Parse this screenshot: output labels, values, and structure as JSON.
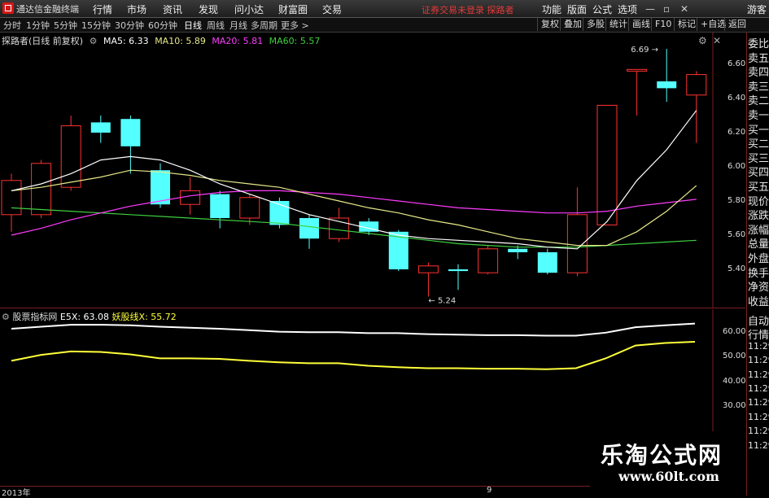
{
  "app": {
    "title": "通达信金融终端",
    "menu": [
      "行情",
      "市场",
      "资讯",
      "发现",
      "问小达",
      "财富圈",
      "交易"
    ],
    "status_msg": "证券交易未登录  探路者",
    "right_menu": [
      "功能",
      "版面",
      "公式",
      "选项"
    ],
    "guest": "游客",
    "window_controls": [
      "—",
      "▫",
      "✕"
    ]
  },
  "periods": {
    "items": [
      "分时",
      "1分钟",
      "5分钟",
      "15分钟",
      "30分钟",
      "60分钟",
      "日线",
      "周线",
      "月线",
      "多周期",
      "更多 >"
    ],
    "active": "日线"
  },
  "toolbar": [
    "复权",
    "叠加",
    "多股",
    "统计",
    "画线",
    "F10",
    "标记",
    "+自选",
    "返回"
  ],
  "legend": {
    "stock": "探路者(日线 前复权)",
    "ma5": "MA5: 6.33",
    "ma10": "MA10: 5.89",
    "ma20": "MA20: 5.81",
    "ma60": "MA60: 5.57"
  },
  "colors": {
    "up": "#ff3232",
    "down": "#54ffff",
    "ma5": "#ffffff",
    "ma10": "#e8e88a",
    "ma20": "#ff3cff",
    "ma60": "#3fcf3f",
    "ind_white": "#ffffff",
    "ind_yellow": "#ffff3a"
  },
  "price_axis": [
    "6.60",
    "6.40",
    "6.20",
    "6.00",
    "5.80",
    "5.60",
    "5.40"
  ],
  "annotations": {
    "high": "6.69",
    "low": "5.24"
  },
  "candles": [
    {
      "o": 5.72,
      "c": 5.92,
      "h": 5.96,
      "l": 5.62
    },
    {
      "o": 5.72,
      "c": 6.02,
      "h": 6.04,
      "l": 5.7
    },
    {
      "o": 5.88,
      "c": 6.24,
      "h": 6.3,
      "l": 5.86
    },
    {
      "o": 6.26,
      "c": 6.2,
      "h": 6.3,
      "l": 6.14
    },
    {
      "o": 6.28,
      "c": 6.12,
      "h": 6.3,
      "l": 5.96
    },
    {
      "o": 5.98,
      "c": 5.78,
      "h": 6.02,
      "l": 5.76
    },
    {
      "o": 5.78,
      "c": 5.86,
      "h": 5.94,
      "l": 5.72
    },
    {
      "o": 5.84,
      "c": 5.7,
      "h": 5.86,
      "l": 5.64
    },
    {
      "o": 5.7,
      "c": 5.82,
      "h": 5.84,
      "l": 5.66
    },
    {
      "o": 5.8,
      "c": 5.66,
      "h": 5.82,
      "l": 5.64
    },
    {
      "o": 5.7,
      "c": 5.58,
      "h": 5.72,
      "l": 5.52
    },
    {
      "o": 5.58,
      "c": 5.7,
      "h": 5.76,
      "l": 5.56
    },
    {
      "o": 5.68,
      "c": 5.62,
      "h": 5.7,
      "l": 5.6
    },
    {
      "o": 5.62,
      "c": 5.4,
      "h": 5.63,
      "l": 5.39
    },
    {
      "o": 5.38,
      "c": 5.42,
      "h": 5.44,
      "l": 5.24
    },
    {
      "o": 5.4,
      "c": 5.39,
      "h": 5.43,
      "l": 5.28
    },
    {
      "o": 5.38,
      "c": 5.52,
      "h": 5.54,
      "l": 5.37
    },
    {
      "o": 5.52,
      "c": 5.5,
      "h": 5.54,
      "l": 5.46
    },
    {
      "o": 5.5,
      "c": 5.38,
      "h": 5.52,
      "l": 5.37
    },
    {
      "o": 5.38,
      "c": 5.72,
      "h": 5.88,
      "l": 5.36
    },
    {
      "o": 5.66,
      "c": 6.36,
      "h": 6.36,
      "l": 5.66
    },
    {
      "o": 6.56,
      "c": 6.57,
      "h": 6.57,
      "l": 6.3
    },
    {
      "o": 6.5,
      "c": 6.46,
      "h": 6.69,
      "l": 6.38
    },
    {
      "o": 6.42,
      "c": 6.54,
      "h": 6.56,
      "l": 6.14
    }
  ],
  "ma": {
    "ma5": [
      5.86,
      5.9,
      5.96,
      6.04,
      6.06,
      6.04,
      5.98,
      5.9,
      5.84,
      5.78,
      5.72,
      5.68,
      5.64,
      5.6,
      5.58,
      5.57,
      5.56,
      5.55,
      5.53,
      5.52,
      5.68,
      5.92,
      6.1,
      6.33
    ],
    "ma10": [
      5.86,
      5.88,
      5.91,
      5.94,
      5.98,
      5.97,
      5.95,
      5.92,
      5.9,
      5.88,
      5.84,
      5.8,
      5.76,
      5.73,
      5.69,
      5.66,
      5.62,
      5.58,
      5.56,
      5.54,
      5.54,
      5.62,
      5.74,
      5.89
    ],
    "ma20": [
      5.6,
      5.64,
      5.69,
      5.73,
      5.77,
      5.8,
      5.83,
      5.85,
      5.86,
      5.86,
      5.85,
      5.84,
      5.82,
      5.8,
      5.78,
      5.76,
      5.75,
      5.74,
      5.73,
      5.73,
      5.74,
      5.77,
      5.79,
      5.81
    ],
    "ma60": [
      5.76,
      5.75,
      5.74,
      5.73,
      5.72,
      5.71,
      5.7,
      5.69,
      5.68,
      5.67,
      5.65,
      5.63,
      5.61,
      5.59,
      5.57,
      5.55,
      5.54,
      5.53,
      5.53,
      5.53,
      5.54,
      5.55,
      5.56,
      5.57
    ]
  },
  "indicator": {
    "name": "股票指标网",
    "e5x": "E5X: 63.08",
    "yyx": "妖股线X: 55.72",
    "axis": [
      "60.00",
      "50.00",
      "40.00",
      "30.00"
    ],
    "white": [
      61.0,
      61.8,
      62.6,
      62.6,
      62.4,
      61.8,
      61.4,
      61.0,
      60.4,
      59.8,
      59.6,
      59.6,
      59.2,
      59.2,
      58.8,
      58.6,
      58.4,
      58.4,
      58.2,
      58.2,
      59.4,
      61.6,
      62.4,
      63.08
    ],
    "yellow": [
      48.0,
      50.4,
      51.8,
      51.6,
      50.6,
      49.0,
      49.0,
      48.8,
      48.0,
      47.4,
      47.0,
      47.0,
      46.0,
      45.4,
      45.0,
      45.0,
      44.8,
      44.8,
      44.6,
      45.0,
      49.0,
      54.2,
      55.2,
      55.72
    ]
  },
  "side_panel": [
    "委比",
    "卖五",
    "卖四",
    "卖三",
    "卖二",
    "卖一",
    "买一",
    "买二",
    "买三",
    "买四",
    "买五",
    "现价",
    "涨跌",
    "涨幅",
    "总量",
    "外盘",
    "换手",
    "净资",
    "收益"
  ],
  "side_panel2": [
    "自动",
    "行情",
    "11:29",
    "11:29",
    "11:29",
    "11:29",
    "11:29",
    "11:29",
    "11:29",
    "11:29"
  ],
  "x_axis": {
    "year": "2013年",
    "month": "9"
  },
  "watermark": {
    "cn": "乐淘公式网",
    "url": "www.60lt.com"
  }
}
